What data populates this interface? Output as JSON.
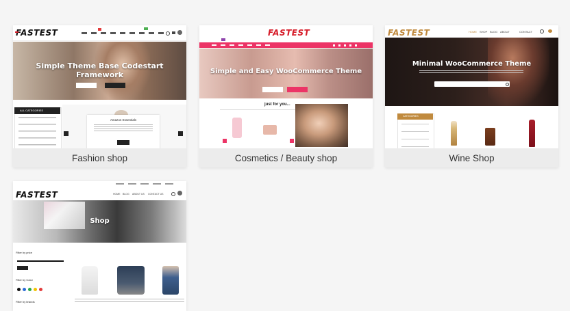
{
  "cards": [
    {
      "caption": "Fashion shop",
      "logo": "FASTEST",
      "hero_title": "Simple Theme Base Codestart Framework",
      "sidebar_header": "ALL CATEGORIES",
      "promo_title": "Amazon Essentials"
    },
    {
      "caption": "Cosmetics / Beauty shop",
      "logo": "FASTEST",
      "hero_title": "Simple and Easy WooCommerce Theme",
      "section_title": "just for you..."
    },
    {
      "caption": "Wine Shop",
      "logo": "FASTEST",
      "hero_title": "Minimal WooCommerce Theme",
      "category_header": "CATEGORIES",
      "nav": [
        "HOME",
        "SHOP",
        "BLOG",
        "ABOUT",
        "CONTACT"
      ]
    },
    {
      "caption": "",
      "logo": "FASTEST",
      "hero_title": "Shop",
      "filters": [
        "Filter by price",
        "Filter by Color",
        "Filter by brands"
      ],
      "nav": [
        "HOME",
        "BLOG",
        "ABOUT US",
        "CONTACT US"
      ],
      "swatch_colors": [
        "#111111",
        "#2b6cd6",
        "#27a745",
        "#f2c200",
        "#e23b3b"
      ]
    }
  ],
  "colors": {
    "logo_red": "#d61d2a",
    "pink_accent": "#ec3466",
    "wine_gold": "#c08a3e"
  }
}
